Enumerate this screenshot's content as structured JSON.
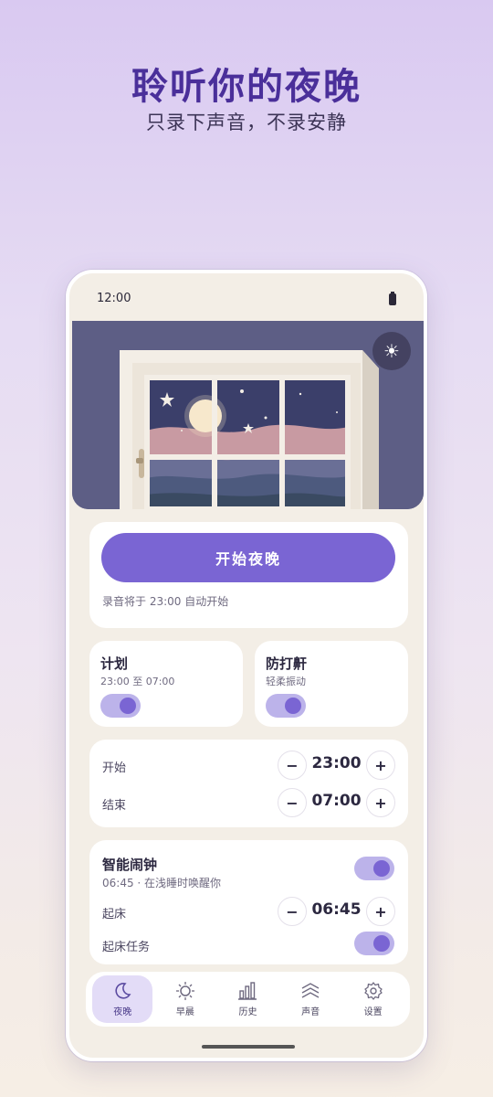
{
  "hero": {
    "title": "聆听你的夜晚",
    "subtitle": "只录下声音，不录安静"
  },
  "status_bar": {
    "time": "12:00"
  },
  "theme_toggle": {
    "icon": "sun-icon"
  },
  "start": {
    "button_label": "开始夜晚",
    "note": "录音将于 23:00 自动开始"
  },
  "plan": {
    "title": "计划",
    "subtitle": "23:00 至 07:00",
    "enabled": true
  },
  "anti_snore": {
    "title": "防打鼾",
    "subtitle": "轻柔振动",
    "enabled": true
  },
  "schedule": {
    "start_label": "开始",
    "start_time": "23:00",
    "end_label": "结束",
    "end_time": "07:00",
    "minus": "−",
    "plus": "+"
  },
  "smart_alarm": {
    "title": "智能闹钟",
    "subtitle": "06:45 · 在浅睡时唤醒你",
    "enabled": true,
    "wake_label": "起床",
    "wake_time": "06:45",
    "task_label": "起床任务",
    "task_enabled": true
  },
  "nav": {
    "items": [
      {
        "label": "夜晚",
        "icon": "moon-icon",
        "active": true
      },
      {
        "label": "早晨",
        "icon": "sun-icon",
        "active": false
      },
      {
        "label": "历史",
        "icon": "bar-chart-icon",
        "active": false
      },
      {
        "label": "声音",
        "icon": "waves-icon",
        "active": false
      },
      {
        "label": "设置",
        "icon": "gear-icon",
        "active": false
      }
    ]
  },
  "colors": {
    "accent": "#7a65d3",
    "toggle_track": "#bcb3ea",
    "hero_title": "#4a2f9a",
    "night_sky": "#5d5e85"
  }
}
